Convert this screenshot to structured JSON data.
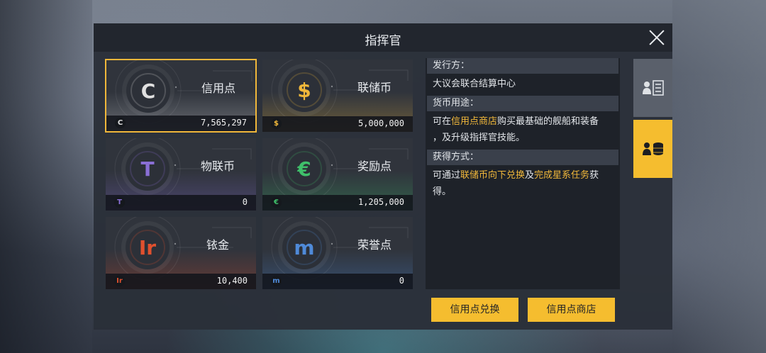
{
  "window": {
    "title": "指挥官"
  },
  "cards": [
    {
      "name": "信用点",
      "value": "7,565,297",
      "glyph": "C",
      "color": "#e0e0e0",
      "selected": true
    },
    {
      "name": "联储币",
      "value": "5,000,000",
      "glyph": "$",
      "color": "#f0b73a",
      "selected": false
    },
    {
      "name": "物联币",
      "value": "0",
      "glyph": "T",
      "color": "#8a6fd6",
      "selected": false
    },
    {
      "name": "奖励点",
      "value": "1,205,000",
      "glyph": "€",
      "color": "#3fbf6a",
      "selected": false
    },
    {
      "name": "铱金",
      "value": "10,400",
      "glyph": "Ir",
      "color": "#e0502e",
      "selected": false
    },
    {
      "name": "荣誉点",
      "value": "0",
      "glyph": "m",
      "color": "#4f8ad8",
      "selected": false
    }
  ],
  "info": {
    "issuer_head": "发行方：",
    "issuer_body": "大议会联合结算中心",
    "usage_head": "货币用途：",
    "usage_pre": "可在",
    "usage_link": "信用点商店",
    "usage_post": "购买最基础的舰船和装备",
    "usage_line2": "，及升级指挥官技能。",
    "obtain_head": "获得方式：",
    "obtain_pre": "可通过",
    "obtain_link1": "联储币向下兑换",
    "obtain_mid": "及",
    "obtain_link2": "完成星系任务",
    "obtain_post": "获",
    "obtain_line2": "得。"
  },
  "buttons": {
    "exchange": "信用点兑换",
    "shop": "信用点商店"
  },
  "side_tabs": [
    {
      "icon": "profile-list-icon",
      "active": false
    },
    {
      "icon": "currency-coins-icon",
      "active": true
    }
  ],
  "colors": {
    "accent": "#f5bd2f",
    "panel": "#2a2f39"
  }
}
